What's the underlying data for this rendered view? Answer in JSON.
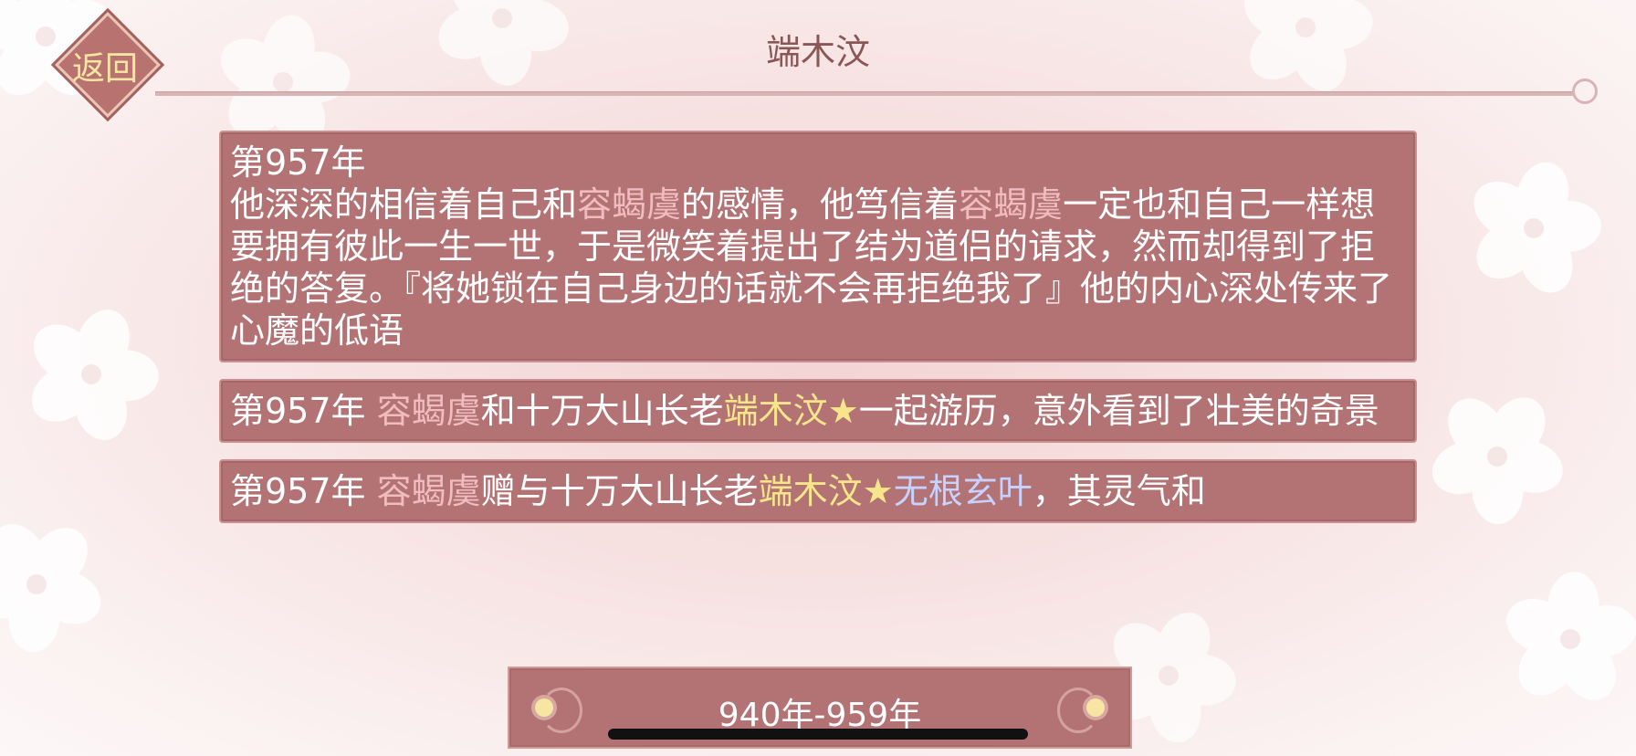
{
  "header": {
    "back_label": "返回",
    "title": "端木汶"
  },
  "events": [
    {
      "year": "第957年",
      "segments": [
        {
          "text": "他深深的相信着自己和",
          "style": "plain"
        },
        {
          "text": "容蝎虞",
          "style": "pink"
        },
        {
          "text": "的感情，他笃信着",
          "style": "plain"
        },
        {
          "text": "容蝎虞",
          "style": "pink"
        },
        {
          "text": "一定也和自己一样想要拥有彼此一生一世，于是微笑着提出了结为道侣的请求，然而却得到了拒绝的答复。『将她锁在自己身边的话就不会再拒绝我了』他的内心深处传来了心魔的低语",
          "style": "plain"
        }
      ]
    },
    {
      "year": "",
      "segments": [
        {
          "text": "第957年 ",
          "style": "plain"
        },
        {
          "text": "容蝎虞",
          "style": "pink"
        },
        {
          "text": "和十万大山长老",
          "style": "plain"
        },
        {
          "text": "端木汶★",
          "style": "gold"
        },
        {
          "text": "一起游历，意外看到了壮美的奇景",
          "style": "plain"
        }
      ]
    },
    {
      "year": "",
      "segments": [
        {
          "text": "第957年 ",
          "style": "plain"
        },
        {
          "text": "容蝎虞",
          "style": "pink"
        },
        {
          "text": "赠与十万大山长老",
          "style": "plain"
        },
        {
          "text": "端木汶★",
          "style": "gold"
        },
        {
          "text": "无根玄叶",
          "style": "blue"
        },
        {
          "text": "，其灵气和",
          "style": "plain"
        }
      ]
    }
  ],
  "era_selector": {
    "label": "940年-959年",
    "prev_icon": "ornate-left-arrow-icon",
    "next_icon": "ornate-right-arrow-icon"
  },
  "colors": {
    "panel": "#b37375",
    "highlight_pink": "#f0bcc0",
    "highlight_gold": "#f6e58a",
    "highlight_blue": "#c8d2ff",
    "title": "#8a5656"
  }
}
